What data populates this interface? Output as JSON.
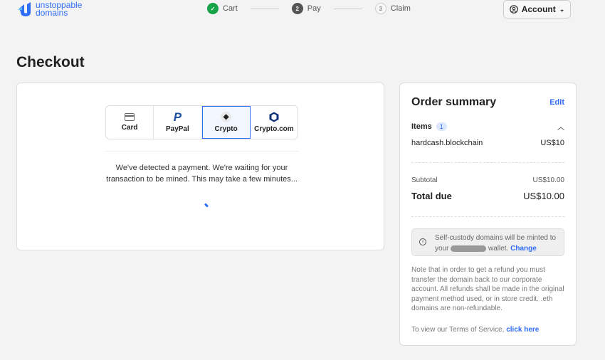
{
  "header": {
    "logo_line1": "unstoppable",
    "logo_line2": "domains",
    "account_label": "Account",
    "steps": [
      {
        "num": "✓",
        "label": "Cart"
      },
      {
        "num": "2",
        "label": "Pay"
      },
      {
        "num": "3",
        "label": "Claim"
      }
    ]
  },
  "page_title": "Checkout",
  "payment": {
    "methods": [
      "Card",
      "PayPal",
      "Crypto",
      "Crypto.com"
    ],
    "selected": "Crypto",
    "message": "We've detected a payment. We're waiting for your transaction to be mined. This may take a few minutes..."
  },
  "summary": {
    "title": "Order summary",
    "edit": "Edit",
    "items_label": "Items",
    "items_count": "1",
    "item_name": "hardcash.blockchain",
    "item_price": "US$10",
    "subtotal_label": "Subtotal",
    "subtotal": "US$10.00",
    "total_label": "Total due",
    "total": "US$10.00",
    "notice_pre": "Self-custody domains will be minted to your",
    "notice_post": "wallet.",
    "notice_link": "Change",
    "refund_note": "Note that in order to get a refund you must transfer the domain back to our corporate account. All refunds shall be made in the original payment method used, or in store credit. .eth domains are non-refundable.",
    "tos_text": "To view our Terms of Service,",
    "tos_link": "click here"
  }
}
